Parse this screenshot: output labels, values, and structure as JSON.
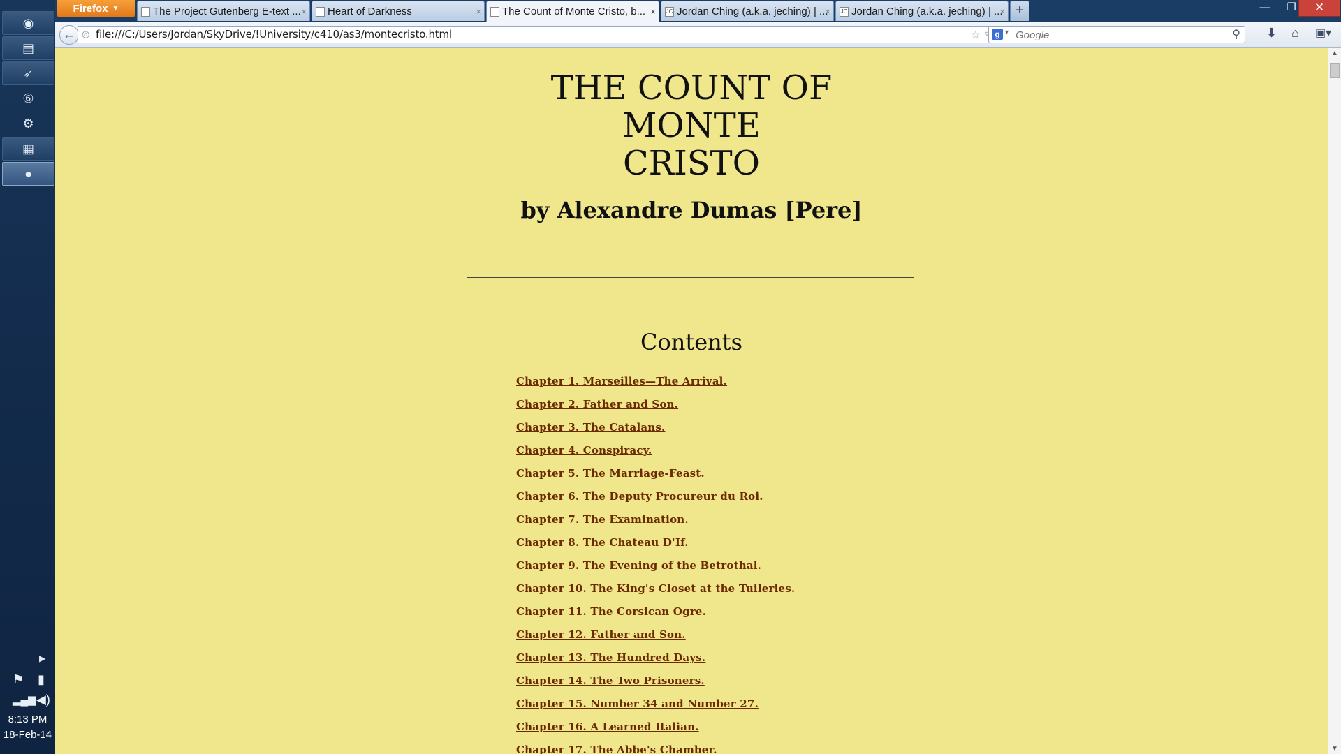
{
  "taskbar": {
    "apps": [
      "chrome-icon",
      "file-explorer-icon",
      "app-icon",
      "app-icon",
      "steam-icon",
      "app-icon",
      "firefox-icon"
    ],
    "clock_time": "8:13 PM",
    "clock_date": "18-Feb-14"
  },
  "browser": {
    "menu_label": "Firefox",
    "tabs": [
      {
        "label": "The Project Gutenberg E-text ..."
      },
      {
        "label": "Heart of Darkness"
      },
      {
        "label": "The Count of Monte Cristo, b..."
      },
      {
        "label": "Jordan Ching (a.k.a. jeching) | ..."
      },
      {
        "label": "Jordan Ching (a.k.a. jeching) | ..."
      }
    ],
    "url": "file:///C:/Users/Jordan/SkyDrive/!University/c410/as3/montecristo.html",
    "search_placeholder": "Google"
  },
  "page": {
    "title_line1": "THE COUNT OF MONTE",
    "title_line2": "CRISTO",
    "author": "by Alexandre Dumas [Pere]",
    "contents_heading": "Contents",
    "chapters": [
      "Chapter 1. Marseilles—The Arrival.",
      "Chapter 2. Father and Son.",
      "Chapter 3. The Catalans.",
      "Chapter 4. Conspiracy.",
      "Chapter 5. The Marriage-Feast.",
      "Chapter 6. The Deputy Procureur du Roi.",
      "Chapter 7. The Examination.",
      "Chapter 8. The Chateau D'If.",
      "Chapter 9. The Evening of the Betrothal.",
      "Chapter 10. The King's Closet at the Tuileries.",
      "Chapter 11. The Corsican Ogre.",
      "Chapter 12. Father and Son.",
      "Chapter 13. The Hundred Days.",
      "Chapter 14. The Two Prisoners.",
      "Chapter 15. Number 34 and Number 27.",
      "Chapter 16. A Learned Italian.",
      "Chapter 17. The Abbe's Chamber."
    ],
    "background_color": "#f0e68c",
    "link_color": "#6b2a00"
  }
}
